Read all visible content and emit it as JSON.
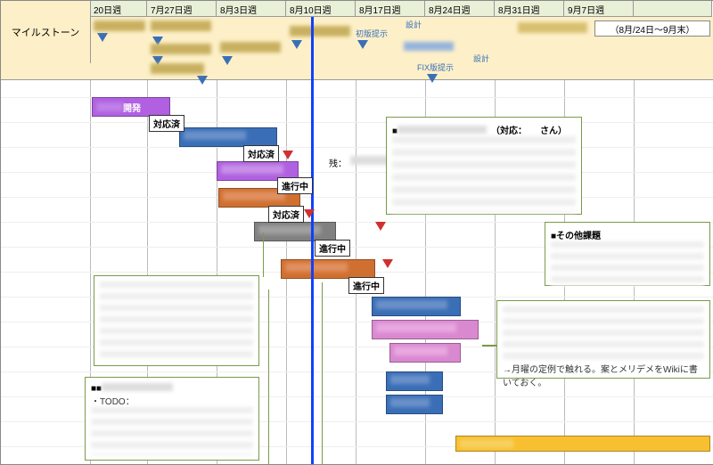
{
  "header": {
    "row_label_blank": "",
    "weeks": [
      "20日週",
      "7月27日週",
      "8月3日週",
      "8月10日週",
      "8月17日週",
      "8月24日週",
      "8月31日週",
      "9月7日週",
      ""
    ]
  },
  "milestone": {
    "label": "マイルストーン",
    "range_field": "（8月/24日〜9月末）"
  },
  "ms_callouts": {
    "c1": {
      "a": "設計",
      "b": "初版提示"
    },
    "c2": {
      "a": "設計",
      "b": "FIX版提示"
    }
  },
  "badges": {
    "done": "対応済",
    "in_progress": "進行中"
  },
  "tasks": {
    "t1": "開発"
  },
  "notes": {
    "n1": {
      "head": "残："
    },
    "n2": {
      "title": "（対応：　　さん）"
    },
    "n3": {
      "title": "■その他課題"
    },
    "n4": {
      "foot": "→月曜の定例で触れる。案とメリデメをWikiに書いておく。"
    },
    "n5": {
      "title": "■",
      "foot": "・TODO："
    },
    "n6": {
      "title": ""
    }
  },
  "chart_data": {
    "type": "gantt",
    "time_unit": "week",
    "columns": [
      "7/20週",
      "7/27週",
      "8/3週",
      "8/10週",
      "8/17週",
      "8/24週",
      "8/31週",
      "9/7週"
    ],
    "today_marker_week": "8/10週中盤",
    "milestone_row": [
      {
        "week": "7/20",
        "markers": 1
      },
      {
        "week": "7/27",
        "markers": 3
      },
      {
        "week": "8/3",
        "markers": 1
      },
      {
        "week": "8/10",
        "markers": 1
      },
      {
        "week": "8/17",
        "label": "設計 初版提示",
        "markers": 1
      },
      {
        "week": "8/24",
        "label": "設計 FIX版提示",
        "markers": 1
      }
    ],
    "range_input": "8/24〜9月末",
    "tasks": [
      {
        "row": 1,
        "color": "purple",
        "start_week": "7/20",
        "span_weeks": 1.3,
        "label": "開発",
        "status": "対応済",
        "arrow": true
      },
      {
        "row": 2,
        "color": "blue",
        "start_week": "7/27後半",
        "span_weeks": 1.5,
        "status": "対応済",
        "arrow": true
      },
      {
        "row": 3,
        "color": "purple",
        "start_week": "8/3",
        "span_weeks": 1.2,
        "status": "進行中"
      },
      {
        "row": 4,
        "color": "orange",
        "start_week": "8/3",
        "span_weeks": 1.2,
        "status": "対応済"
      },
      {
        "row": 5,
        "color": "gray",
        "start_week": "8/3後半",
        "span_weeks": 1.2,
        "status": "進行中",
        "arrow": true
      },
      {
        "row": 6,
        "color": "orange",
        "start_week": "8/10",
        "span_weeks": 1.4,
        "status": "進行中",
        "arrow": true
      },
      {
        "row": 7,
        "color": "blue",
        "start_week": "8/17",
        "span_weeks": 1.3,
        "arrow": true
      },
      {
        "row": 8,
        "color": "pink",
        "start_week": "8/17",
        "span_weeks": 1.5
      },
      {
        "row": 9,
        "color": "pink",
        "start_week": "8/17後半",
        "span_weeks": 1.0
      },
      {
        "row": 10,
        "color": "blue",
        "start_week": "8/17後半",
        "span_weeks": 0.8
      },
      {
        "row": 11,
        "color": "blue",
        "start_week": "8/17後半",
        "span_weeks": 0.8
      },
      {
        "row": 12,
        "color": "yellow",
        "start_week": "8/24",
        "span_weeks": 3.5
      }
    ],
    "notes": [
      {
        "id": "n2",
        "approx_anchor": "row2右",
        "text": "（対応：〜さん）"
      },
      {
        "id": "n3",
        "approx_anchor": "右上",
        "text": "■その他課題"
      },
      {
        "id": "n4",
        "approx_anchor": "row8-9右",
        "text": "→月曜の定例で触れる。案とメリデメをWikiに書いておく。"
      },
      {
        "id": "n5",
        "approx_anchor": "左下",
        "text": "■ / ・TODO："
      },
      {
        "id": "n6",
        "approx_anchor": "row5-6左下"
      }
    ]
  }
}
